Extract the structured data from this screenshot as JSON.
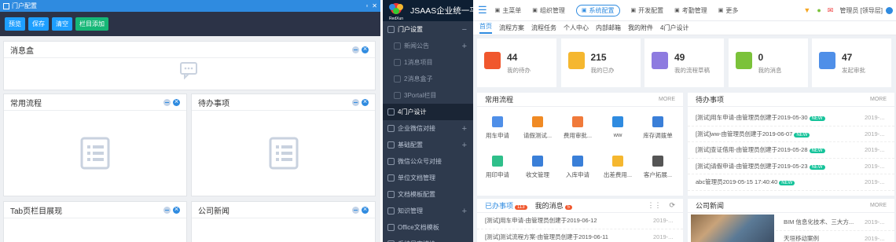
{
  "left": {
    "window_title": "门户配置",
    "toolbar": [
      "预览",
      "保存",
      "清空",
      "栏目添加"
    ],
    "cards": {
      "msgbox": "消息盒",
      "flow": "常用流程",
      "todo": "待办事项",
      "tab": "Tab页栏目展现",
      "news": "公司新闻"
    }
  },
  "nav": {
    "brand": "JSAAS企业统一平台",
    "logo_text": "RedXun",
    "items": [
      {
        "label": "门户设置",
        "kind": "sec",
        "icon": "home-icon",
        "plus": "−"
      },
      {
        "label": "新闻公告",
        "kind": "sub",
        "plus": "+"
      },
      {
        "label": "1消息项目",
        "kind": "sub"
      },
      {
        "label": "2消息盒子",
        "kind": "sub"
      },
      {
        "label": "3Portal栏目",
        "kind": "sub"
      },
      {
        "label": "4门户设计",
        "kind": "act"
      },
      {
        "label": "企业微信对接",
        "kind": "norm",
        "plus": "+"
      },
      {
        "label": "基础配置",
        "kind": "norm",
        "plus": "+"
      },
      {
        "label": "微信公众号对接",
        "kind": "norm"
      },
      {
        "label": "单位文档管理",
        "kind": "norm"
      },
      {
        "label": "文档模板配置",
        "kind": "norm"
      },
      {
        "label": "知识管理",
        "kind": "norm",
        "plus": "+"
      },
      {
        "label": "Office文档模板",
        "kind": "norm"
      },
      {
        "label": "系统日志模块",
        "kind": "norm"
      }
    ]
  },
  "topbar": {
    "items": [
      {
        "label": "主菜单",
        "icon": "monitor-icon"
      },
      {
        "label": "组织管理",
        "icon": "org-icon"
      },
      {
        "label": "系统配置",
        "icon": "settings-icon",
        "active": true
      },
      {
        "label": "开发配置",
        "icon": "code-icon"
      },
      {
        "label": "考勤管理",
        "icon": "clock-icon"
      },
      {
        "label": "更多",
        "icon": "more-icon"
      }
    ],
    "user": "管理员 [领导层]"
  },
  "tabs": [
    "首页",
    "流程方案",
    "流程任务",
    "个人中心",
    "内部邮箱",
    "我的附件",
    "4门户设计"
  ],
  "stats": [
    {
      "num": "44",
      "label": "我的待办",
      "color": "#f0572d"
    },
    {
      "num": "215",
      "label": "我的已办",
      "color": "#f5b72f"
    },
    {
      "num": "49",
      "label": "我的流程草稿",
      "color": "#8e7be0"
    },
    {
      "num": "0",
      "label": "我的消息",
      "color": "#7bc23a"
    },
    {
      "num": "47",
      "label": "发起审批",
      "color": "#4f8fe8"
    }
  ],
  "flow": {
    "title": "常用流程",
    "more": "MORE",
    "items": [
      {
        "label": "用车申请",
        "color": "#4f8fe8"
      },
      {
        "label": "请假测试...",
        "color": "#f08a24"
      },
      {
        "label": "费用审批...",
        "color": "#f07a3a"
      },
      {
        "label": "ww",
        "color": "#2f8be0"
      },
      {
        "label": "库存调拨单",
        "color": "#3a7fd8"
      },
      {
        "label": "用印申请",
        "color": "#2fbf8a"
      },
      {
        "label": "收文管理",
        "color": "#3a7fd8"
      },
      {
        "label": "入库申请",
        "color": "#3a7fd8"
      },
      {
        "label": "出差费用...",
        "color": "#f5b72f"
      },
      {
        "label": "客户拓展...",
        "color": "#555"
      }
    ]
  },
  "todo": {
    "title": "待办事项",
    "more": "MORE",
    "items": [
      {
        "text": "[测试]用车申请-由管理员创建于2019-05-30",
        "date": "2019-..."
      },
      {
        "text": "[测试]ww-由管理员创建于2019-06-07",
        "date": "2019-..."
      },
      {
        "text": "[测试]查证借用-由管理员创建于2019-05-28",
        "date": "2019-..."
      },
      {
        "text": "[测试]请假申请-由管理员创建于2019-05-23",
        "date": "2019-..."
      },
      {
        "text": "abc管理员2019-05-15 17:40:40",
        "date": "2019-..."
      }
    ],
    "badge": "NEW"
  },
  "tabbox": {
    "tab1": "已办事项",
    "tab1_count": "113",
    "tab2": "我的消息",
    "tab2_count": "5",
    "items": [
      {
        "text": "[测试]用车申请-由管理员创建于2019-06-12",
        "date": "2019-..."
      },
      {
        "text": "[测试]测试流程方案-由管理员创建于2019-06-11",
        "date": "2019-..."
      }
    ]
  },
  "news": {
    "title": "公司新闻",
    "more": "MORE",
    "items": [
      {
        "text": "BIM 信息化技术、三大方...",
        "date": "2019-..."
      },
      {
        "text": "天垣移动案例",
        "date": "2019-..."
      }
    ]
  }
}
